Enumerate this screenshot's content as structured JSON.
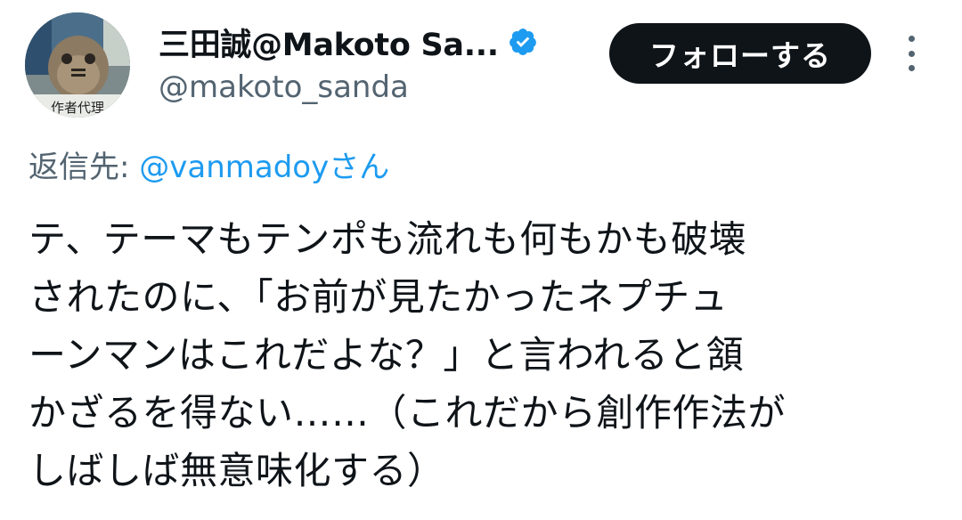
{
  "author": {
    "display_name": "三田誠@Makoto Sa...",
    "handle": "@makoto_sanda",
    "avatar_caption": "作者代理",
    "verified": true,
    "verified_color": "#1d9bf0"
  },
  "actions": {
    "follow_label": "フォローする",
    "more_icon": "more-vertical-icon"
  },
  "reply": {
    "prefix": "返信先: ",
    "mention": "@vanmadoy",
    "suffix": "さん"
  },
  "tweet": {
    "lines": [
      "テ、テーマもテンポも流れも何もかも破壊",
      "されたのに、「お前が見たかったネプチュ",
      "ーンマンはこれだよな？」と言われると頷",
      "かざるを得ない……（これだから創作作法が",
      "しばしば無意味化する）"
    ]
  },
  "colors": {
    "text": "#0f1419",
    "secondary": "#536471",
    "accent": "#1d9bf0",
    "button_bg": "#0f1419"
  }
}
